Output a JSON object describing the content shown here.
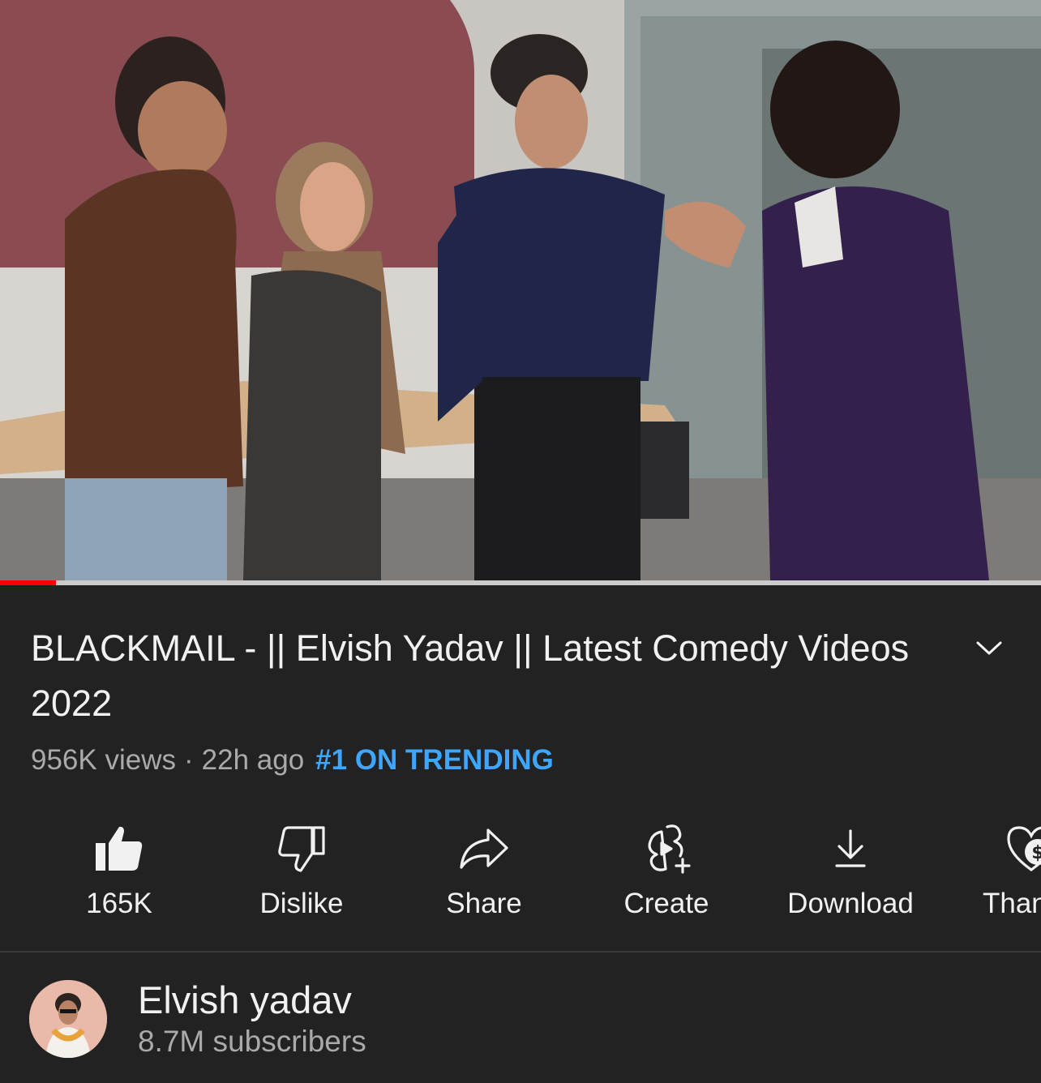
{
  "player": {
    "progress_fraction": 0.054,
    "buffered_fraction": 1.0
  },
  "video": {
    "title": "BLACKMAIL - || Elvish Yadav || Latest Comedy Videos 2022",
    "views": "956K views",
    "separator": "·",
    "age": "22h ago",
    "trending_label": "#1 ON TRENDING"
  },
  "actions": [
    {
      "label": "165K",
      "icon": "thumbs-up-filled-icon"
    },
    {
      "label": "Dislike",
      "icon": "thumbs-down-icon"
    },
    {
      "label": "Share",
      "icon": "share-arrow-icon"
    },
    {
      "label": "Create",
      "icon": "create-shorts-icon"
    },
    {
      "label": "Download",
      "icon": "download-icon"
    },
    {
      "label": "Thanks",
      "icon": "super-thanks-heart-icon"
    }
  ],
  "channel": {
    "name": "Elvish yadav",
    "subscribers": "8.7M subscribers"
  },
  "colors": {
    "background": "#222222",
    "accent_link": "#3ea6ff",
    "progress_red": "#ff0000",
    "secondary_text": "#aaaaaa"
  }
}
